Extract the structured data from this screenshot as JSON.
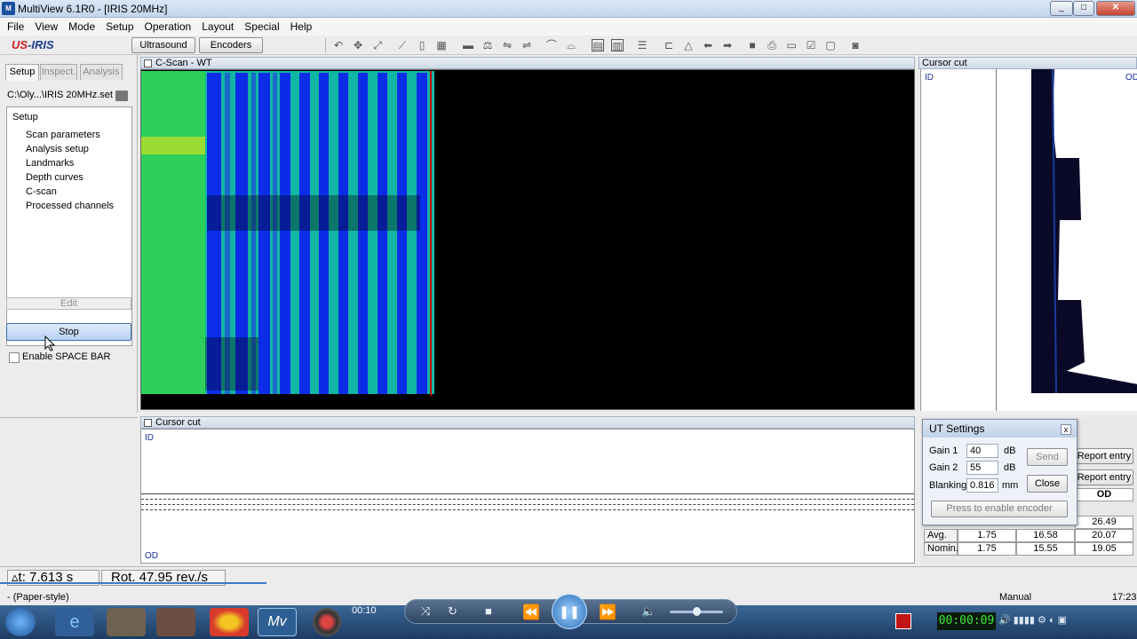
{
  "window": {
    "title": "MultiView 6.1R0 - [IRIS 20MHz]",
    "icon_label": "M",
    "buttons": [
      "_",
      "□",
      "✕"
    ]
  },
  "menu": [
    "File",
    "View",
    "Mode",
    "Setup",
    "Operation",
    "Layout",
    "Special",
    "Help"
  ],
  "toolbar": {
    "logo_us": "US",
    "logo_iris": "-IRIS",
    "ultrasound_label": "Ultrasound",
    "encoders_label": "Encoders"
  },
  "left_panel": {
    "tabs": [
      "Setup",
      "Inspect.",
      "Analysis"
    ],
    "file_path": "C:\\Oly...\\IRIS 20MHz.set",
    "tree_root": "Setup",
    "tree_items": [
      "Scan parameters",
      "Analysis setup",
      "Landmarks",
      "Depth curves",
      "C-scan",
      "Processed channels"
    ],
    "edit_label": "Edit",
    "stop_label": "Stop",
    "spacebar_label": "Enable SPACE BAR"
  },
  "cscan": {
    "title": "C-Scan - WT"
  },
  "cursor_cut_right": {
    "title": "Cursor cut",
    "id_label": "ID",
    "od_label": "OD"
  },
  "cursor_cut_bottom": {
    "title": "Cursor cut",
    "id_label": "ID",
    "od_label": "OD"
  },
  "ut_settings": {
    "title": "UT Settings",
    "close_x": "x",
    "gain1": {
      "label": "Gain 1",
      "value": "40",
      "unit": "dB"
    },
    "gain2": {
      "label": "Gain 2",
      "value": "55",
      "unit": "dB"
    },
    "blanking": {
      "label": "Blanking",
      "value": "0.816",
      "unit": "mm"
    },
    "send_label": "Send",
    "close_label": "Close",
    "encoder_label": "Press to enable encoder"
  },
  "report": {
    "entry1": "Report entry",
    "entry2": "Report entry",
    "od_header": "OD",
    "partial_value": "26.49",
    "rows": [
      {
        "label": "Avg.",
        "values": [
          "1.75",
          "16.58",
          "20.07"
        ]
      },
      {
        "label": "Nomin.",
        "values": [
          "1.75",
          "15.55",
          "19.05"
        ]
      }
    ]
  },
  "status": {
    "dt": "t: 7.613 s",
    "rot": "Rot. 47.95 rev./s",
    "paper": "- (Paper-style)",
    "mode": "Manual",
    "clock": "17:23"
  },
  "media": {
    "time": "00:10",
    "counter": "00:00:09"
  }
}
